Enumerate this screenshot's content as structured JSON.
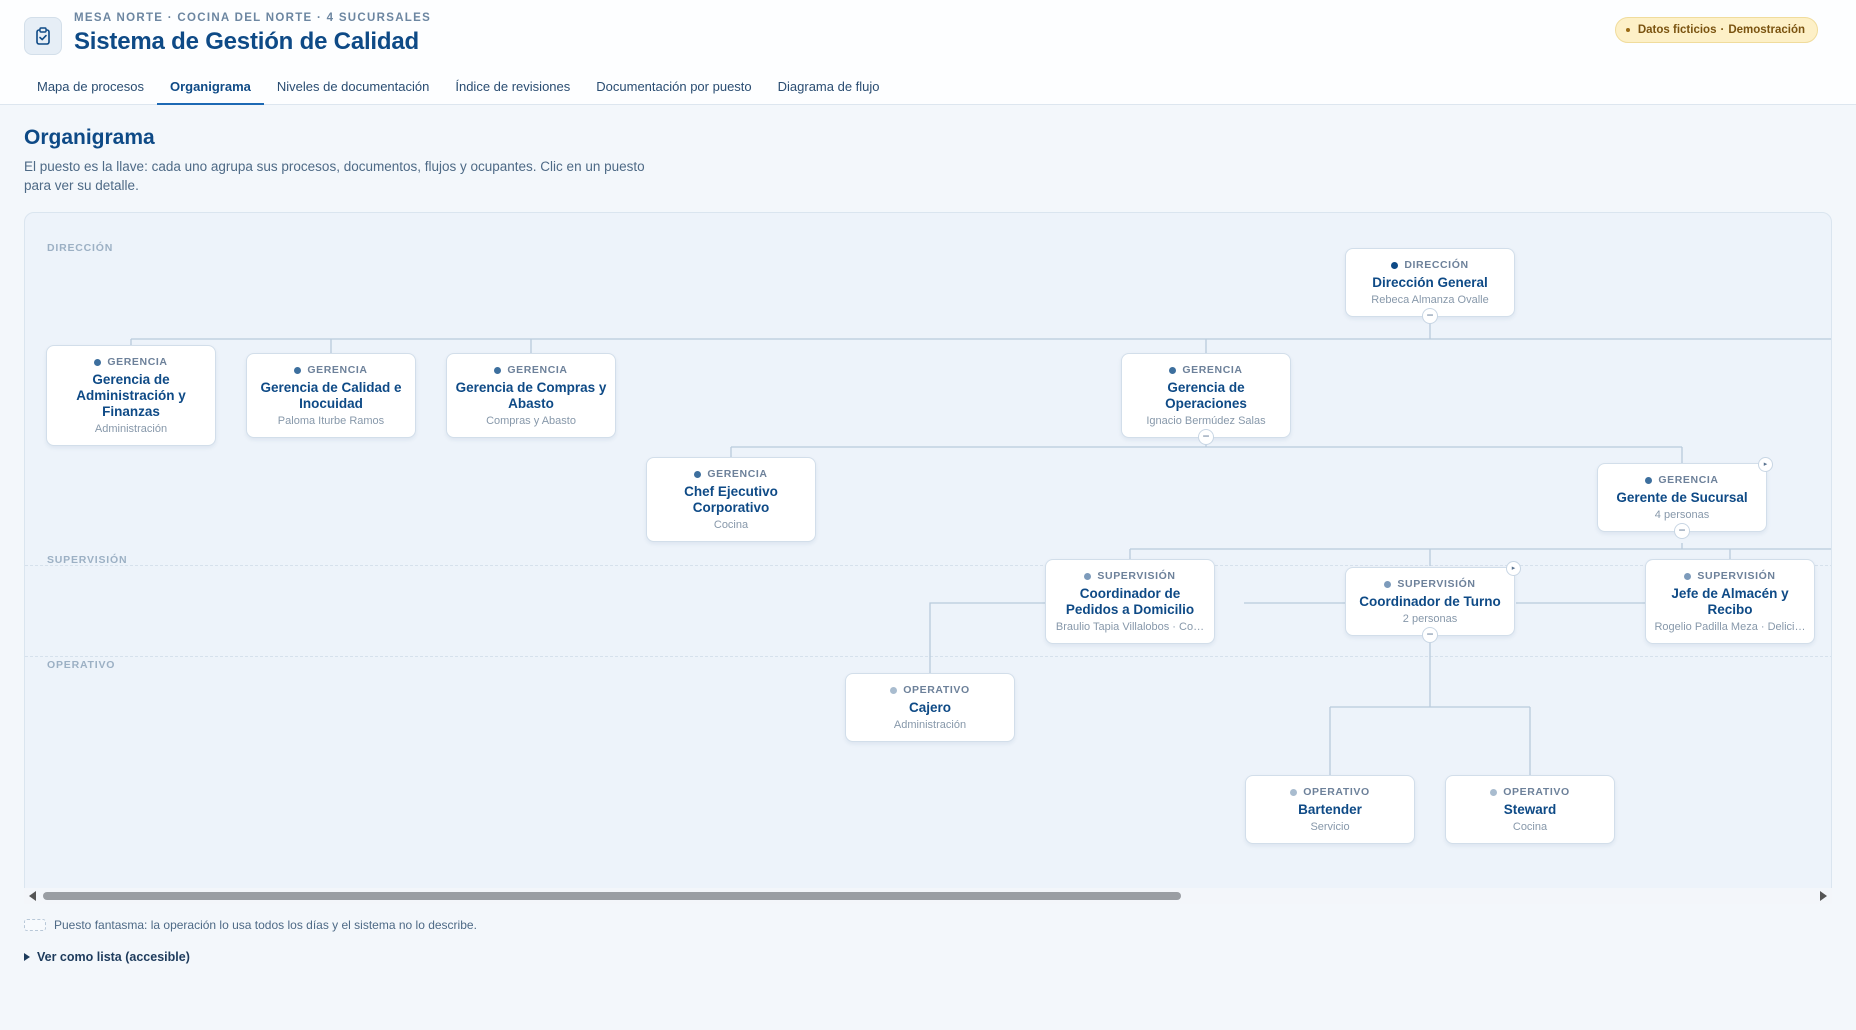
{
  "header": {
    "eyebrow": "MESA NORTE · COCINA DEL NORTE · 4 SUCURSALES",
    "title": "Sistema de Gestión de Calidad",
    "badge_a": "Datos ficticios",
    "badge_sep": "·",
    "badge_b": "Demostración"
  },
  "tabs": [
    {
      "label": "Mapa de procesos"
    },
    {
      "label": "Organigrama",
      "active": true
    },
    {
      "label": "Niveles de documentación"
    },
    {
      "label": "Índice de revisiones"
    },
    {
      "label": "Documentación por puesto"
    },
    {
      "label": "Diagrama de flujo"
    }
  ],
  "page": {
    "title": "Organigrama",
    "description": "El puesto es la llave: cada uno agrupa sus procesos, documentos, flujos y ocupantes. Clic en un puesto para ver su detalle."
  },
  "bands": {
    "direccion": "DIRECCIÓN",
    "supervision": "SUPERVISIÓN",
    "operativo": "OPERATIVO"
  },
  "level_colors": {
    "DIRECCIÓN": "#0e4a86",
    "GERENCIA": "#3d6f9e",
    "SUPERVISIÓN": "#7d9bbb",
    "OPERATIVO": "#a9bccf"
  },
  "toggle_glyph": "−",
  "corner_glyph": "▸",
  "nodes": {
    "direccion_general": {
      "level": "DIRECCIÓN",
      "name": "Dirección General",
      "sub": "Rebeca Almanza Ovalle"
    },
    "ger_admin": {
      "level": "GERENCIA",
      "name": "Gerencia de Administración y Finanzas",
      "sub": "Administración"
    },
    "ger_calidad": {
      "level": "GERENCIA",
      "name": "Gerencia de Calidad e Inocuidad",
      "sub": "Paloma Iturbe Ramos"
    },
    "ger_compras": {
      "level": "GERENCIA",
      "name": "Gerencia de Compras y Abasto",
      "sub": "Compras y Abasto"
    },
    "ger_operaciones": {
      "level": "GERENCIA",
      "name": "Gerencia de Operaciones",
      "sub": "Ignacio Bermúdez Salas"
    },
    "chef_ejecutivo": {
      "level": "GERENCIA",
      "name": "Chef Ejecutivo Corporativo",
      "sub": "Cocina"
    },
    "gerente_sucursal": {
      "level": "GERENCIA",
      "name": "Gerente de Sucursal",
      "sub": "4 personas"
    },
    "coord_pedidos": {
      "level": "SUPERVISIÓN",
      "name": "Coordinador de Pedidos a Domicilio",
      "sub": "Braulio Tapia Villalobos · Co…"
    },
    "coord_turno": {
      "level": "SUPERVISIÓN",
      "name": "Coordinador de Turno",
      "sub": "2 personas"
    },
    "jefe_almacen": {
      "level": "SUPERVISIÓN",
      "name": "Jefe de Almacén y Recibo",
      "sub": "Rogelio Padilla Meza · Delici…"
    },
    "cajero": {
      "level": "OPERATIVO",
      "name": "Cajero",
      "sub": "Administración"
    },
    "bartender": {
      "level": "OPERATIVO",
      "name": "Bartender",
      "sub": "Servicio"
    },
    "steward": {
      "level": "OPERATIVO",
      "name": "Steward",
      "sub": "Cocina"
    }
  },
  "legend": {
    "ghost_text": "Puesto fantasma: la operación lo usa todos los días y el sistema no lo describe."
  },
  "list_toggle": "Ver como lista (accesible)"
}
